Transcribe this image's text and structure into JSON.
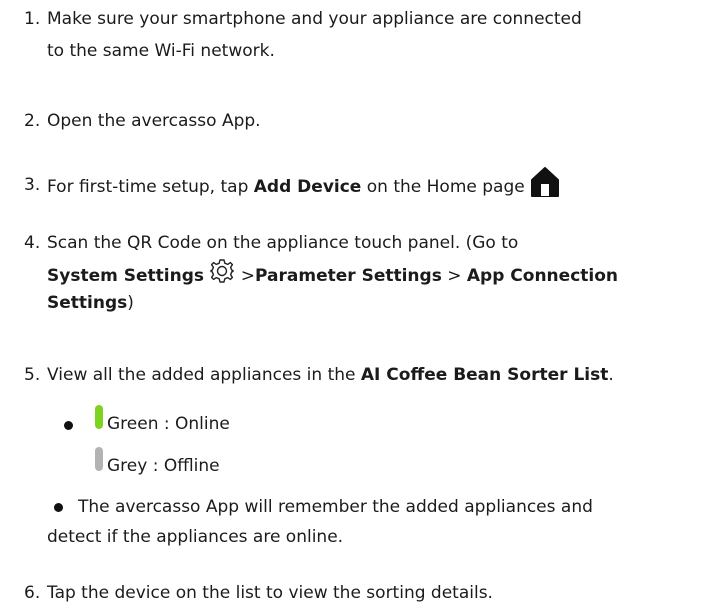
{
  "steps": [
    {
      "num": "1.",
      "l1": "Make sure your smartphone and your appliance are connected",
      "l2": "to the same Wi-Fi network."
    },
    {
      "num": "2.",
      "text": "Open the avercasso App."
    },
    {
      "num": "3.",
      "pre": "For first-time setup, tap ",
      "bold": "Add Device",
      "post": " on the Home page"
    },
    {
      "num": "4.",
      "l1": "Scan the QR Code on the appliance touch panel. (Go to",
      "sys": "System Settings",
      "gt1": " >",
      "param": "Parameter Settings",
      "gt2": " > ",
      "app": "App Connection",
      "settings": "Settings",
      "close": ")"
    },
    {
      "num": "5.",
      "pre": "View all the added appliances in the ",
      "bold": "AI Coffee Bean Sorter List",
      "post": "."
    },
    {
      "num": "6.",
      "text": "Tap the device on the list to view the sorting details."
    }
  ],
  "status": {
    "green": "Green : Online",
    "grey": "Grey : Offline",
    "green_color": "#7ed321",
    "grey_color": "#b3b3b3"
  },
  "note": {
    "l1": "The avercasso App will remember the added appliances and",
    "l2": "detect if the appliances are online."
  },
  "icons": {
    "home": "home-icon",
    "settings": "gear-icon"
  }
}
